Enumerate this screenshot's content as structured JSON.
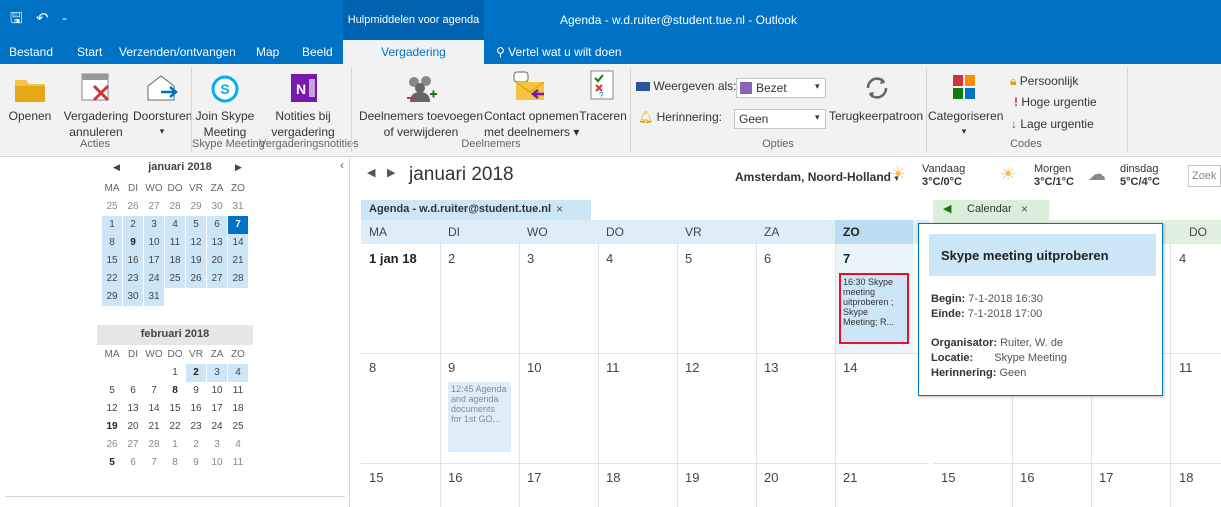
{
  "window": {
    "title": "Agenda - w.d.ruiter@student.tue.nl  -  Outlook",
    "contextual_tab_group": "Hulpmiddelen voor agenda"
  },
  "tabs": [
    "Bestand",
    "Start",
    "Verzenden/ontvangen",
    "Map",
    "Beeld",
    "Vergadering"
  ],
  "tell_me": "Vertel wat u wilt doen",
  "ribbon": {
    "acties": {
      "label": "Acties",
      "open": "Openen",
      "cancel_1": "Vergadering",
      "cancel_2": "annuleren",
      "forward": "Doorsturen"
    },
    "skype": {
      "label": "Skype Meeting",
      "join_1": "Join Skype",
      "join_2": "Meeting"
    },
    "notes": {
      "label": "Vergaderingsnotities",
      "n1": "Notities bij",
      "n2": "vergadering"
    },
    "attendees": {
      "label": "Deelnemers",
      "add_1": "Deelnemers toevoegen",
      "add_2": "of verwijderen",
      "contact_1": "Contact opnemen",
      "contact_2": "met deelnemers",
      "track": "Traceren"
    },
    "options": {
      "label": "Opties",
      "show_as_label": "Weergeven als:",
      "show_as_value": "Bezet",
      "reminder_label": "Herinnering:",
      "reminder_value": "Geen",
      "recurrence": "Terugkeerpatroon"
    },
    "tags": {
      "label": "Codes",
      "categorize": "Categoriseren",
      "private": "Persoonlijk",
      "high": "Hoge urgentie",
      "low": "Lage urgentie"
    }
  },
  "mini_calendar": {
    "month1": "januari 2018",
    "month2": "februari 2018",
    "weekdays": [
      "MA",
      "DI",
      "WO",
      "DO",
      "VR",
      "ZA",
      "ZO"
    ],
    "jan_weeks": [
      [
        "25",
        "26",
        "27",
        "28",
        "29",
        "30",
        "31"
      ],
      [
        "1",
        "2",
        "3",
        "4",
        "5",
        "6",
        "7"
      ],
      [
        "8",
        "9",
        "10",
        "11",
        "12",
        "13",
        "14"
      ],
      [
        "15",
        "16",
        "17",
        "18",
        "19",
        "20",
        "21"
      ],
      [
        "22",
        "23",
        "24",
        "25",
        "26",
        "27",
        "28"
      ],
      [
        "29",
        "30",
        "31",
        "",
        "",
        "",
        ""
      ]
    ],
    "feb_weeks": [
      [
        "",
        "",
        "",
        "1",
        "2",
        "3",
        "4"
      ],
      [
        "5",
        "6",
        "7",
        "8",
        "9",
        "10",
        "11"
      ],
      [
        "12",
        "13",
        "14",
        "15",
        "16",
        "17",
        "18"
      ],
      [
        "19",
        "20",
        "21",
        "22",
        "23",
        "24",
        "25"
      ],
      [
        "26",
        "27",
        "28",
        "1",
        "2",
        "3",
        "4"
      ],
      [
        "5",
        "6",
        "7",
        "8",
        "9",
        "10",
        "11"
      ]
    ]
  },
  "main": {
    "month_title": "januari 2018",
    "location": "Amsterdam, Noord-Holland",
    "weather": [
      {
        "day": "Vandaag",
        "temp": "3°C/0°C",
        "icon": "sun-icon"
      },
      {
        "day": "Morgen",
        "temp": "3°C/1°C",
        "icon": "sun-icon"
      },
      {
        "day": "dinsdag",
        "temp": "5°C/4°C",
        "icon": "cloud-icon"
      }
    ],
    "search_placeholder": "Zoek",
    "tab1": "Agenda - w.d.ruiter@student.tue.nl",
    "tab2": "Calendar",
    "day_headers": [
      "MA",
      "DI",
      "WO",
      "DO",
      "VR",
      "ZA",
      "ZO"
    ],
    "rows": [
      [
        "1 jan 18",
        "2",
        "3",
        "4",
        "5",
        "6",
        "7"
      ],
      [
        "8",
        "9",
        "10",
        "11",
        "12",
        "13",
        "14"
      ],
      [
        "15",
        "16",
        "17",
        "18",
        "19",
        "20",
        "21"
      ]
    ],
    "second_calendar": {
      "day_header": "DO",
      "row_dates": [
        "4",
        "11",
        "18"
      ],
      "row3": [
        "15",
        "16",
        "17"
      ]
    },
    "appointment_selected": "16:30 Skype meeting uitproberen ; Skype Meeting; R...",
    "appointment_other": "12:45 Agenda and agenda documents for 1st GO..."
  },
  "peek": {
    "title": "Skype meeting uitproberen",
    "begin_label": "Begin:",
    "begin": "7-1-2018  16:30",
    "end_label": "Einde:",
    "end": "7-1-2018  17:00",
    "organizer_label": "Organisator:",
    "organizer": "Ruiter, W. de",
    "location_label": "Locatie:",
    "location": "Skype Meeting",
    "reminder_label": "Herinnering:",
    "reminder": "Geen"
  },
  "colors": {
    "brand": "#0072c6",
    "selected_day": "#0072c6",
    "appt_border": "#e81123",
    "peek_title_bg": "#cde6f7"
  }
}
